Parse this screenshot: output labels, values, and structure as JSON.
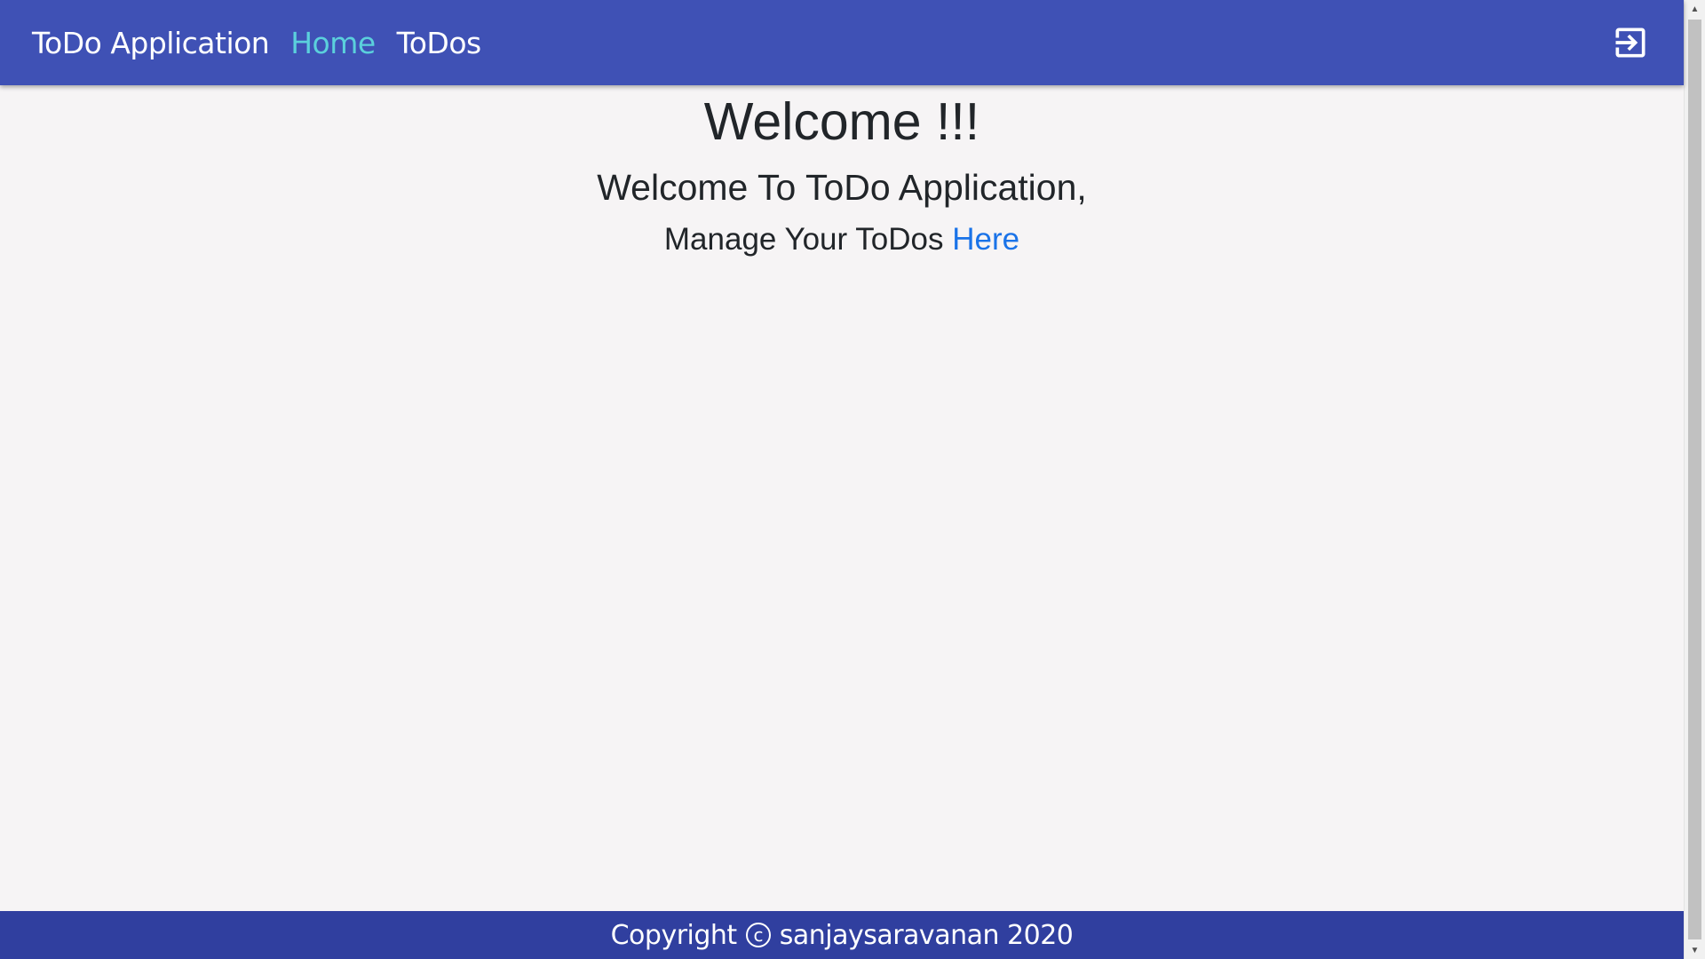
{
  "navbar": {
    "brand": "ToDo Application",
    "links": [
      {
        "label": "Home",
        "active": true
      },
      {
        "label": "ToDos",
        "active": false
      }
    ],
    "logout_icon": "logout-icon",
    "background_color": "#3f51b5",
    "active_link_color": "#5bd0dc"
  },
  "main": {
    "title": "Welcome !!!",
    "subtitle": "Welcome To ToDo Application,",
    "manage_text": "Manage Your ToDos ",
    "manage_link": "Here",
    "link_color": "#1a73e8"
  },
  "footer": {
    "copyright_label": "Copyright",
    "copyright_symbol": "c",
    "owner": "sanjaysaravanan 2020",
    "background_color": "#303f9f"
  },
  "scrollbar": {
    "up_arrow": "▲",
    "down_arrow": "▼"
  }
}
